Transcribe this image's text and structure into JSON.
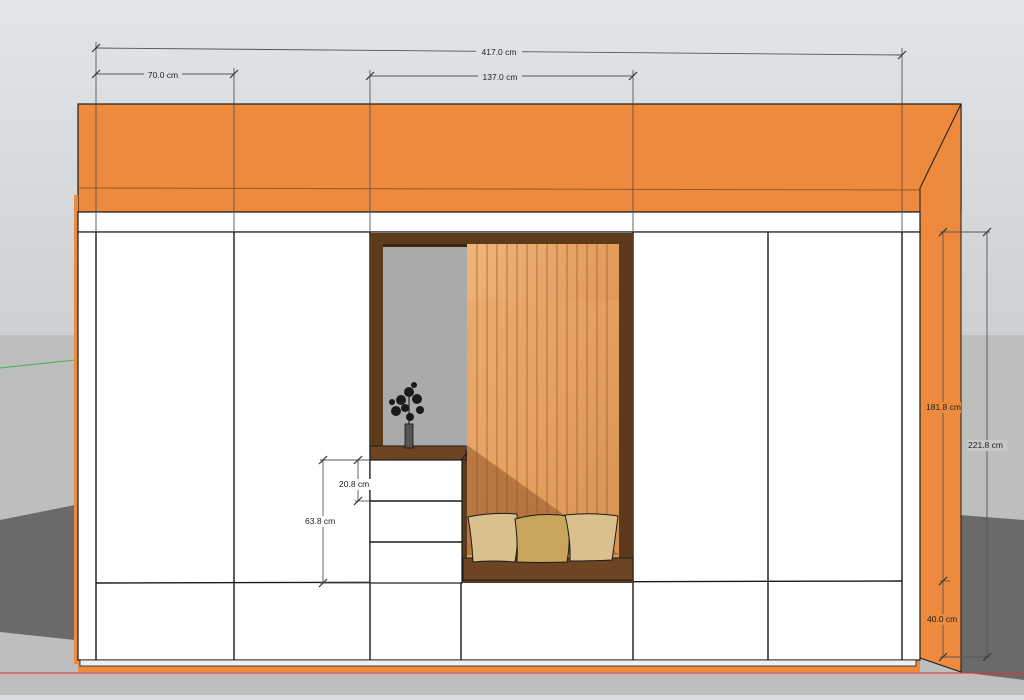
{
  "colors": {
    "sky_top": "#dfe2e5",
    "sky_bottom": "#cfd3d6",
    "ground_light": "#bfc0c0",
    "ground_dark": "#6f6f6f",
    "orange": "#ee8a3e",
    "orange_edge": "#b86325",
    "cabinet": "#ffffff",
    "line": "#1a1a1a",
    "wood_dark": "#5e3a1c",
    "slat_light": "#e7a467",
    "slat_shadow": "#a86a37",
    "back_wall": "#a9aaab",
    "cushion": "#d8b673",
    "cushion_shade": "#bf9a52",
    "dimension": "#555555"
  },
  "dimensions": {
    "total_width": "417.0 cm",
    "left_module_width": "70.0 cm",
    "niche_width": "137.0 cm",
    "upper_height": "181.8 cm",
    "total_height": "221.8 cm",
    "base_height": "40.0 cm",
    "drawer_height": "20.8 cm",
    "drawer_stack_height": "63.8 cm"
  }
}
